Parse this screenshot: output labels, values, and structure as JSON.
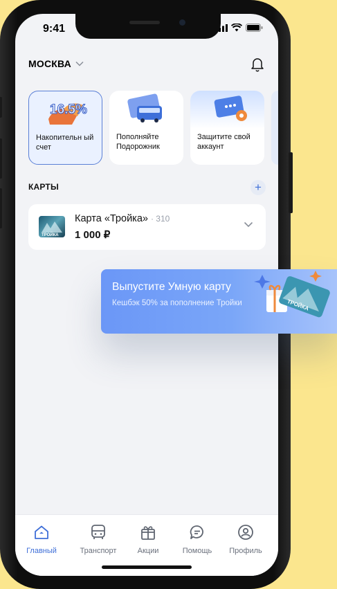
{
  "status": {
    "time": "9:41"
  },
  "header": {
    "city": "МОСКВА"
  },
  "stories": [
    {
      "label": "Накопительн ый счет",
      "badge": "16.5%"
    },
    {
      "label": "Пополняйте Подорожник"
    },
    {
      "label": "Защитите свой аккаунт"
    }
  ],
  "cards_section": {
    "title": "КАРТЫ",
    "add": "+"
  },
  "card": {
    "name": "Карта «Тройка»",
    "number": "· 310",
    "balance": "1 000 ₽",
    "thumb_text": "ТРОЙКА"
  },
  "banner": {
    "title": "Выпустите Умную карту",
    "subtitle": "Кешбэк 50% за пополнение Тройки",
    "card_text": "ТРОЙКА"
  },
  "tabs": [
    {
      "label": "Главный",
      "icon": "home-icon"
    },
    {
      "label": "Транспорт",
      "icon": "bus-icon"
    },
    {
      "label": "Акции",
      "icon": "gift-icon"
    },
    {
      "label": "Помощь",
      "icon": "chat-icon"
    },
    {
      "label": "Профиль",
      "icon": "profile-icon"
    }
  ],
  "colors": {
    "accent": "#3f6fd8",
    "background": "#fbe68e",
    "banner": "#6b97f7"
  }
}
